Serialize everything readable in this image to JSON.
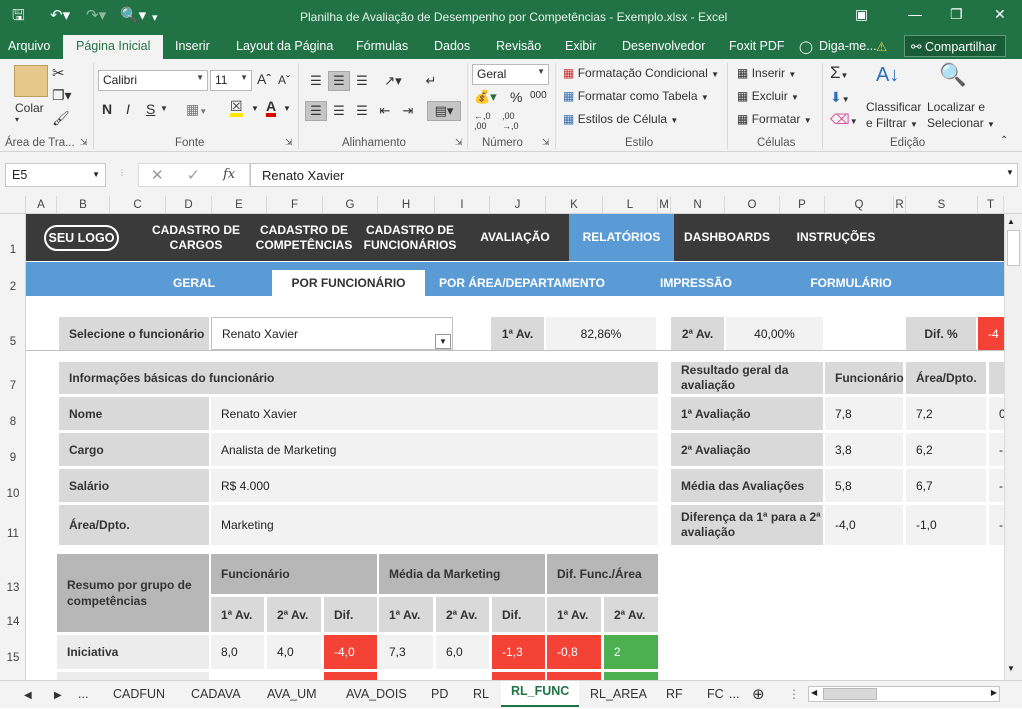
{
  "window": {
    "title": "Planilha de Avaliação de Desempenho por Competências - Exemplo.xlsx - Excel"
  },
  "ribbon_tabs": [
    "Arquivo",
    "Página Inicial",
    "Inserir",
    "Layout da Página",
    "Fórmulas",
    "Dados",
    "Revisão",
    "Exibir",
    "Desenvolvedor",
    "Foxit PDF",
    "Diga-me..."
  ],
  "share_label": "Compartilhar",
  "ribbon": {
    "paste_label": "Colar",
    "font_name": "Calibri",
    "font_size": "11",
    "bold": "N",
    "italic": "I",
    "underline": "S",
    "number_format": "Geral",
    "cond_format": "Formatação Condicional",
    "format_table": "Formatar como Tabela",
    "cell_styles": "Estilos de Célula",
    "insert": "Inserir",
    "delete": "Excluir",
    "format": "Formatar",
    "sort_filter_1": "Classificar",
    "sort_filter_2": "e Filtrar",
    "find_select_1": "Localizar e",
    "find_select_2": "Selecionar",
    "groups": [
      "Área de Tra...",
      "Fonte",
      "Alinhamento",
      "Número",
      "Estilo",
      "Células",
      "Edição"
    ]
  },
  "formula_bar": {
    "name_box": "E5",
    "fx": "fx",
    "value": "Renato Xavier"
  },
  "columns": [
    "A",
    "B",
    "C",
    "D",
    "E",
    "F",
    "G",
    "H",
    "I",
    "J",
    "K",
    "L",
    "M",
    "N",
    "O",
    "P",
    "Q",
    "R",
    "S",
    "T"
  ],
  "rows": [
    "1",
    "2",
    "5",
    "7",
    "8",
    "9",
    "10",
    "11",
    "13",
    "14",
    "15"
  ],
  "nav": {
    "logo": "SEU LOGO",
    "items": [
      "CADASTRO DE CARGOS",
      "CADASTRO DE COMPETÊNCIAS",
      "CADASTRO DE FUNCIONÁRIOS",
      "AVALIAÇÃO",
      "RELATÓRIOS",
      "DASHBOARDS",
      "INSTRUÇÕES"
    ],
    "sub": [
      "GERAL",
      "POR FUNCIONÁRIO",
      "POR ÁREA/DEPARTAMENTO",
      "IMPRESSÃO",
      "FORMULÁRIO"
    ]
  },
  "selector": {
    "label": "Selecione o funcionário",
    "value": "Renato Xavier",
    "av1_label": "1ª Av.",
    "av1_value": "82,86%",
    "av2_label": "2ª Av.",
    "av2_value": "40,00%",
    "dif_label": "Dif. %",
    "dif_value": "-4"
  },
  "info": {
    "title": "Informações básicas do funcionário",
    "rows": [
      {
        "label": "Nome",
        "value": "Renato Xavier"
      },
      {
        "label": "Cargo",
        "value": "Analista de Marketing"
      },
      {
        "label": "Salário",
        "value": "R$ 4.000"
      },
      {
        "label": "Área/Dpto.",
        "value": "Marketing"
      }
    ]
  },
  "result": {
    "title": "Resultado geral da avaliação",
    "col1": "Funcionário",
    "col2": "Área/Dpto.",
    "rows": [
      {
        "label": "1ª Avaliação",
        "f": "7,8",
        "a": "7,2",
        "x": "0"
      },
      {
        "label": "2ª Avaliação",
        "f": "3,8",
        "a": "6,2",
        "x": "-"
      },
      {
        "label": "Média das Avaliações",
        "f": "5,8",
        "a": "6,7",
        "x": "-"
      },
      {
        "label": "Diferença da 1ª para a 2ª avaliação",
        "f": "-4,0",
        "a": "-1,0",
        "x": "-"
      }
    ]
  },
  "summary": {
    "title": "Resumo por grupo de competências",
    "group1": "Funcionário",
    "group2": "Média da Marketing",
    "group3": "Dif. Func./Área",
    "sub": [
      "1ª Av.",
      "2ª Av.",
      "Dif.",
      "1ª Av.",
      "2ª Av.",
      "Dif.",
      "1ª Av.",
      "2ª Av."
    ],
    "row": {
      "name": "Iniciativa",
      "values": [
        "8,0",
        "4,0",
        "-4,0",
        "7,3",
        "6,0",
        "-1,3",
        "-0,8",
        "2"
      ]
    }
  },
  "sheets": [
    "...",
    "CADFUN",
    "CADAVA",
    "AVA_UM",
    "AVA_DOIS",
    "PD",
    "RL",
    "RL_FUNC",
    "RL_AREA",
    "RF",
    "FC",
    "..."
  ],
  "colors": {
    "excel_green": "#217346",
    "nav_dark": "#3a3a3a",
    "nav_blue": "#5b9bd5",
    "red": "#f44336",
    "green": "#4caf50"
  }
}
